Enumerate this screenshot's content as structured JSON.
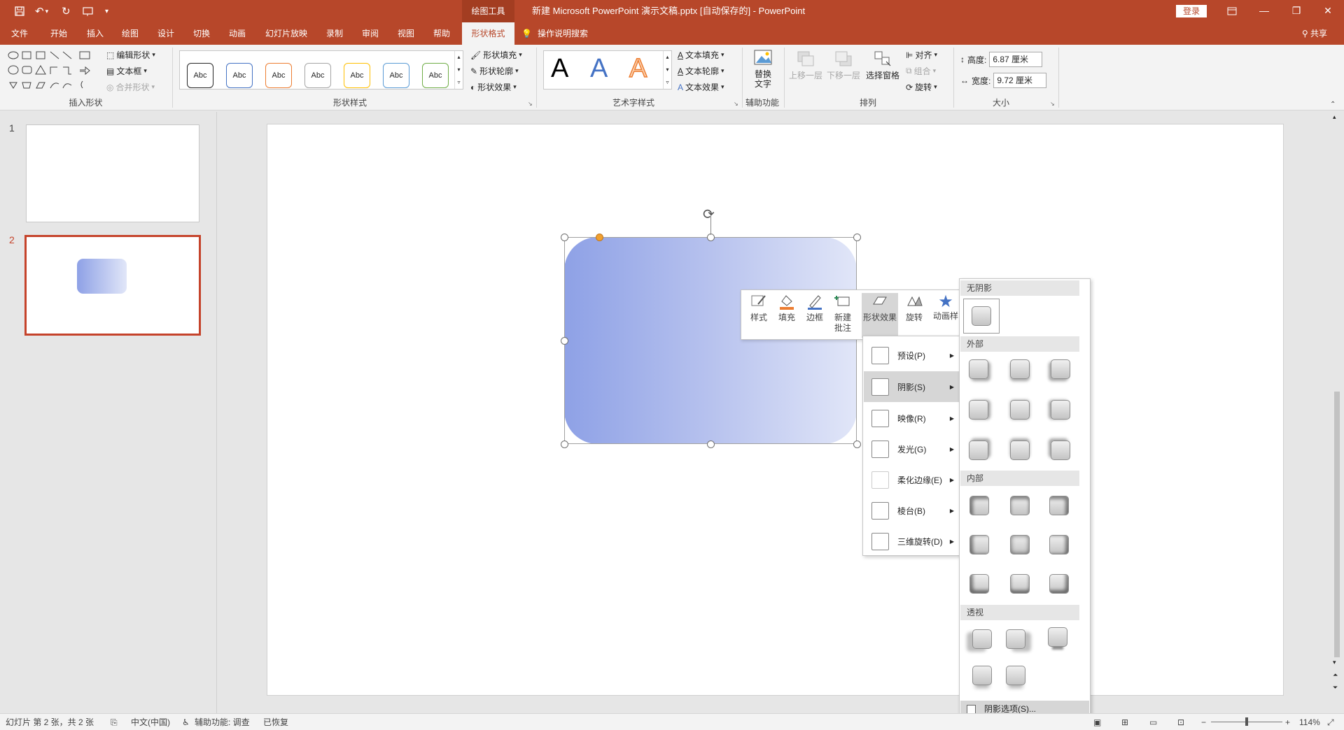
{
  "titlebar": {
    "context_tools": "绘图工具",
    "document_title": "新建 Microsoft PowerPoint 演示文稿.pptx [自动保存的]  -  PowerPoint",
    "login": "登录",
    "icons": [
      "save-icon",
      "undo-icon",
      "redo-icon",
      "start-from-beginning-icon",
      "customize-icon",
      "ribbon-display-icon",
      "minimize-icon",
      "restore-icon",
      "close-icon"
    ]
  },
  "tabs": {
    "items": [
      "文件",
      "开始",
      "插入",
      "绘图",
      "设计",
      "切换",
      "动画",
      "幻灯片放映",
      "录制",
      "审阅",
      "视图",
      "帮助",
      "形状格式"
    ],
    "active": "形状格式",
    "tell_me": "操作说明搜索",
    "share": "共享"
  },
  "ribbon": {
    "insert_shapes": {
      "label": "插入形状",
      "edit_shape": "编辑形状",
      "text_box": "文本框",
      "merge_shapes": "合并形状"
    },
    "shape_styles": {
      "label": "形状样式",
      "preset_text": "Abc",
      "preset_colors": [
        "#262626",
        "#4472c4",
        "#ed7d31",
        "#a5a5a5",
        "#ffc000",
        "#5b9bd5",
        "#70ad47"
      ],
      "shape_fill": "形状填充",
      "shape_outline": "形状轮廓",
      "shape_effects": "形状效果"
    },
    "wordart": {
      "label": "艺术字样式",
      "letter": "A",
      "text_fill": "文本填充",
      "text_outline": "文本轮廓",
      "text_effects": "文本效果"
    },
    "accessibility": {
      "label": "辅助功能",
      "alt_text_1": "替换",
      "alt_text_2": "文字"
    },
    "arrange": {
      "label": "排列",
      "bring_forward": "上移一层",
      "send_backward": "下移一层",
      "selection_pane": "选择窗格",
      "align": "对齐",
      "group": "组合",
      "rotate": "旋转"
    },
    "size": {
      "label": "大小",
      "height_label": "高度:",
      "height_value": "6.87 厘米",
      "width_label": "宽度:",
      "width_value": "9.72 厘米"
    }
  },
  "slides": {
    "items": [
      {
        "num": "1"
      },
      {
        "num": "2"
      }
    ],
    "active": "2"
  },
  "shape": {
    "gradient_from": "#8ea1e6",
    "gradient_to": "#e1e6f8"
  },
  "mini_toolbar": {
    "style": "样式",
    "fill": "填充",
    "border": "边框",
    "new_comment_1": "新建",
    "new_comment_2": "批注",
    "shape_effects": "形状效果",
    "rotate": "旋转",
    "animation": "动画样"
  },
  "effects_menu": {
    "items": [
      "预设(P)",
      "阴影(S)",
      "映像(R)",
      "发光(G)",
      "柔化边缘(E)",
      "棱台(B)",
      "三维旋转(D)"
    ],
    "selected": "阴影(S)"
  },
  "shadow_gallery": {
    "no_shadow": "无阴影",
    "outer": "外部",
    "inner": "内部",
    "perspective": "透视",
    "options": "阴影选项(S)..."
  },
  "status": {
    "slide_info": "幻灯片 第 2 张，共 2 张",
    "language": "中文(中国)",
    "accessibility": "辅助功能: 调查",
    "recovered": "已恢复",
    "zoom": "114%"
  },
  "colors": {
    "accent": "#b7472a",
    "thumb_selected": "#c5432b"
  }
}
